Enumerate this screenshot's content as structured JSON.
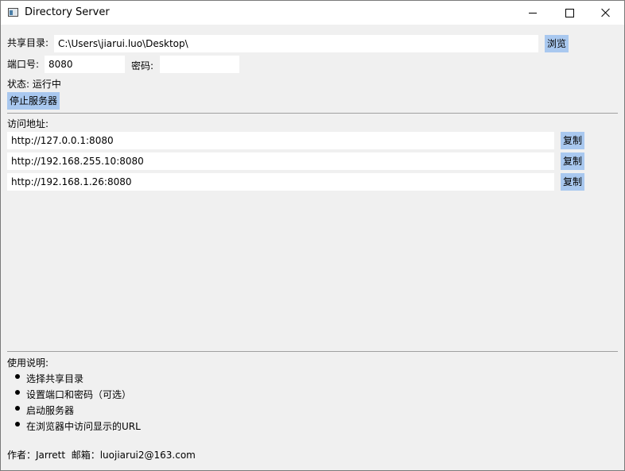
{
  "window": {
    "title": "Directory Server"
  },
  "form": {
    "share_dir_label": "共享目录:",
    "share_dir_value": "C:\\Users\\jiarui.luo\\Desktop\\",
    "browse_label": "浏览",
    "port_label": "端口号:",
    "port_value": "8080",
    "password_label": "密码:",
    "password_value": ""
  },
  "status": {
    "text": "状态: 运行中",
    "stop_button_label": "停止服务器"
  },
  "access": {
    "label": "访问地址:",
    "urls": [
      {
        "url": "http://127.0.0.1:8080",
        "copy_label": "复制"
      },
      {
        "url": "http://192.168.255.10:8080",
        "copy_label": "复制"
      },
      {
        "url": "http://192.168.1.26:8080",
        "copy_label": "复制"
      }
    ]
  },
  "instructions": {
    "title": "使用说明:",
    "items": [
      "选择共享目录",
      "设置端口和密码（可选）",
      "启动服务器",
      "在浏览器中访问显示的URL"
    ]
  },
  "footer": {
    "text": "作者：Jarrett  邮箱：luojiarui2@163.com"
  }
}
